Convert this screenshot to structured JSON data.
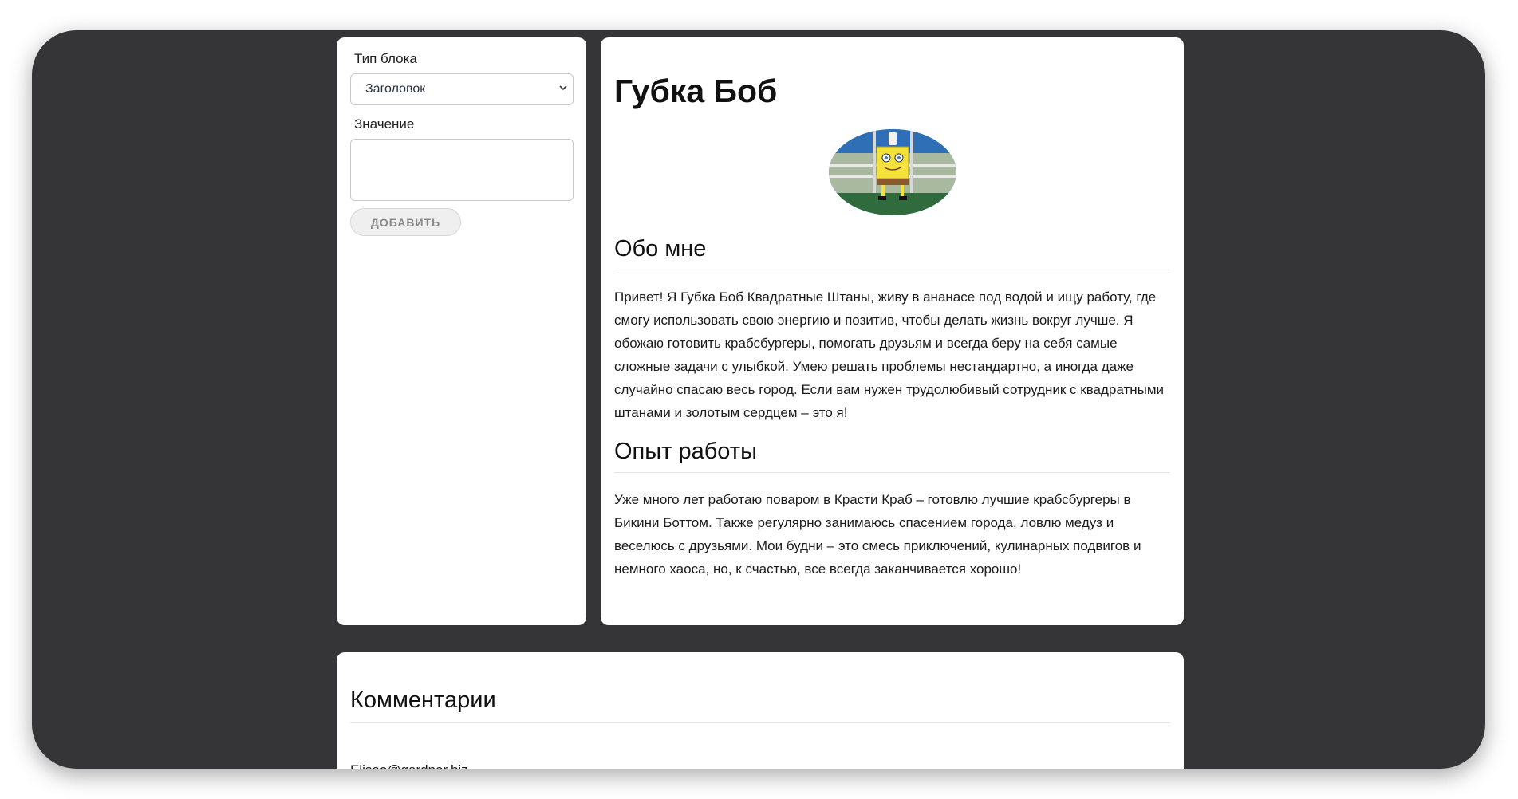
{
  "editor": {
    "block_type_label": "Тип блока",
    "block_type_selected": "Заголовок",
    "value_label": "Значение",
    "value_text": "",
    "add_button": "ДОБАВИТЬ"
  },
  "resume": {
    "name": "Губка Боб",
    "avatar_icon": "spongebob-avatar-icon",
    "sections": [
      {
        "heading": "Обо мне",
        "text": "Привет! Я Губка Боб Квадратные Штаны, живу в ананасе под водой и ищу работу, где смогу использовать свою энергию и позитив, чтобы делать жизнь вокруг лучше. Я обожаю готовить крабсбургеры, помогать друзьям и всегда беру на себя самые сложные задачи с улыбкой. Умею решать проблемы нестандартно, а иногда даже случайно спасаю весь город. Если вам нужен трудолюбивый сотрудник с квадратными штанами и золотым сердцем – это я!"
      },
      {
        "heading": "Опыт работы",
        "text": "Уже много лет работаю поваром в Красти Краб – готовлю лучшие крабсбургеры в Бикини Боттом. Также регулярно занимаюсь спасением города, ловлю медуз и веселюсь с друзьями. Мои будни – это смесь приключений, кулинарных подвигов и немного хаоса, но, к счастью, все всегда заканчивается хорошо!"
      }
    ]
  },
  "comments": {
    "title": "Комментарии",
    "first_author": "Eliseo@gardner.biz"
  },
  "colors": {
    "background": "#353537",
    "card": "#ffffff",
    "button_bg": "#efefef",
    "button_text": "#8a8a8a"
  }
}
